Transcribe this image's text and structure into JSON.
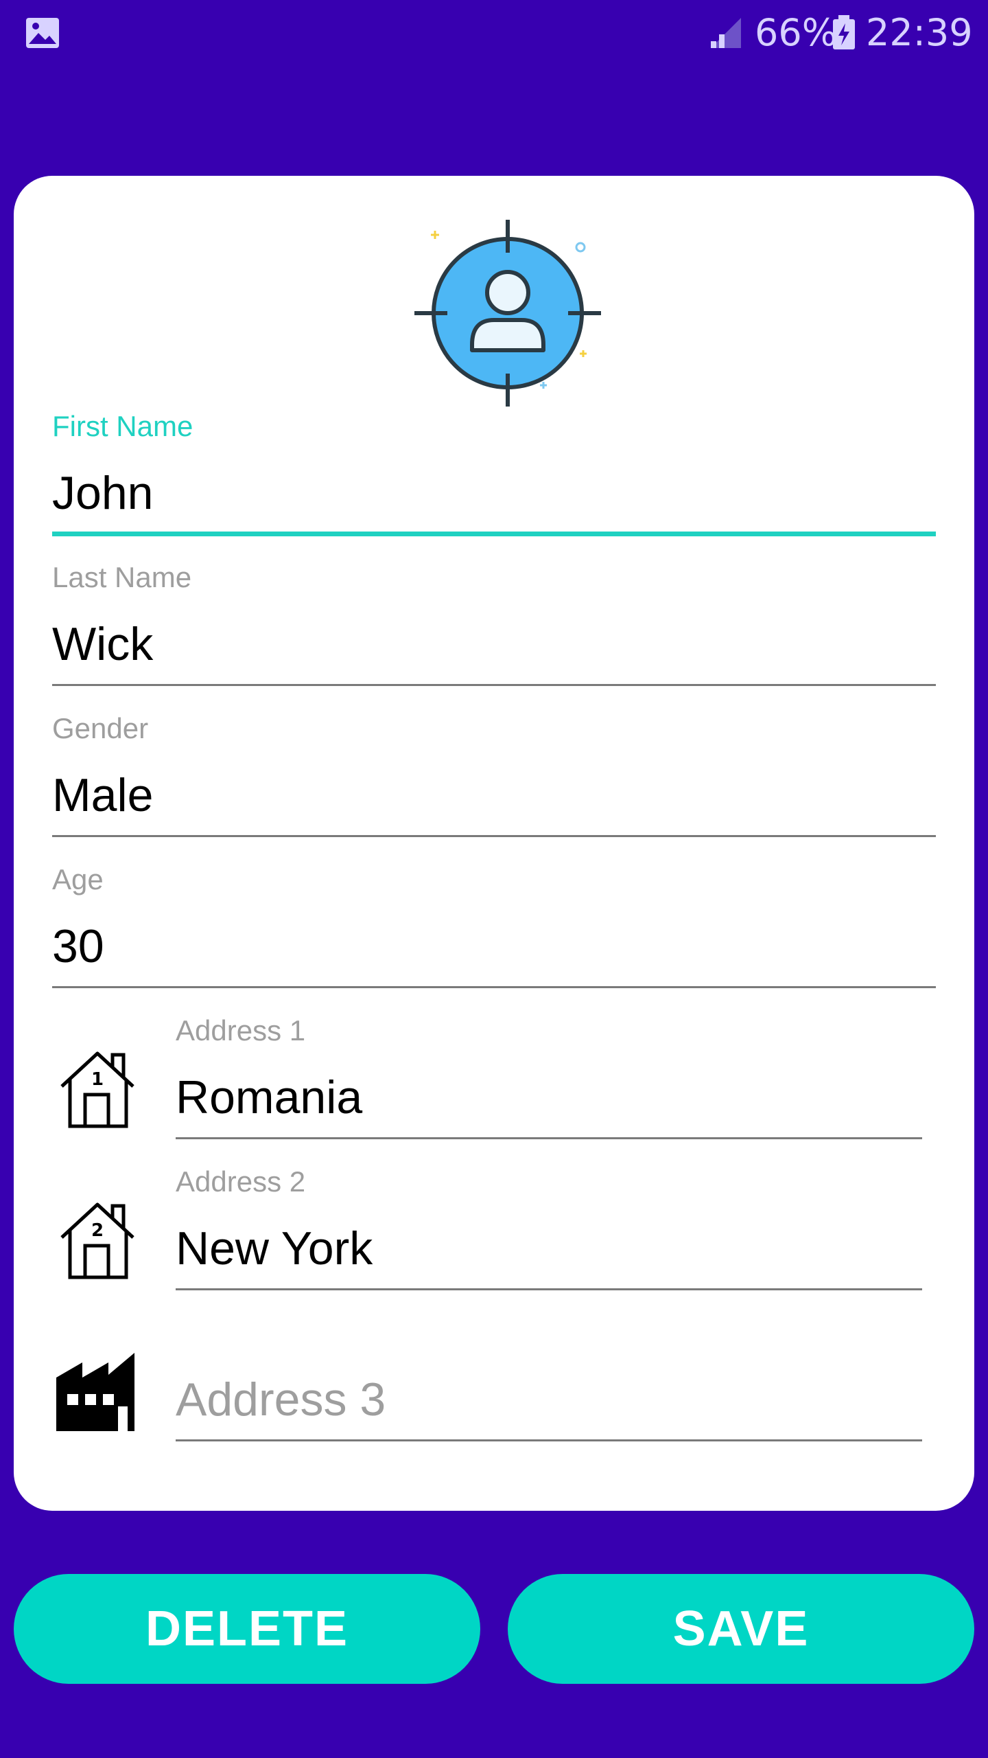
{
  "status_bar": {
    "battery_percent": "66%",
    "time": "22:39",
    "icons": [
      "gallery-icon",
      "signal-icon",
      "battery-charging-icon"
    ]
  },
  "form": {
    "avatar_icon": "user-target-icon",
    "first_name": {
      "label": "First Name",
      "value": "John"
    },
    "last_name": {
      "label": "Last Name",
      "value": "Wick"
    },
    "gender": {
      "label": "Gender",
      "value": "Male"
    },
    "age": {
      "label": "Age",
      "value": "30"
    },
    "address1": {
      "label": "Address 1",
      "value": "Romania",
      "icon": "house-1-icon"
    },
    "address2": {
      "label": "Address 2",
      "value": "New York",
      "icon": "house-2-icon"
    },
    "address3": {
      "placeholder": "Address 3",
      "value": "",
      "icon": "factory-icon"
    }
  },
  "buttons": {
    "delete": "DELETE",
    "save": "SAVE"
  },
  "colors": {
    "background": "#3800b0",
    "accent": "#00d6c5",
    "card": "#ffffff"
  }
}
